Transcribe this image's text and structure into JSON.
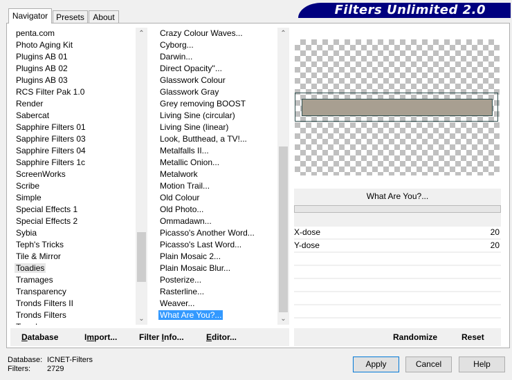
{
  "app": {
    "title": "Filters Unlimited 2.0"
  },
  "tabs": [
    {
      "label": "Navigator",
      "active": true
    },
    {
      "label": "Presets",
      "active": false
    },
    {
      "label": "About",
      "active": false
    }
  ],
  "categories": {
    "items": [
      "penta.com",
      "Photo Aging Kit",
      "Plugins AB 01",
      "Plugins AB 02",
      "Plugins AB 03",
      "RCS Filter Pak 1.0",
      "Render",
      "Sabercat",
      "Sapphire Filters 01",
      "Sapphire Filters 03",
      "Sapphire Filters 04",
      "Sapphire Filters 1c",
      "ScreenWorks",
      "Scribe",
      "Simple",
      "Special Effects 1",
      "Special Effects 2",
      "Sybia",
      "Teph's Tricks",
      "Tile & Mirror",
      "Toadies",
      "Tramages",
      "Transparency",
      "Tronds Filters II",
      "Tronds Filters",
      "Tronds..."
    ],
    "selected": "Toadies"
  },
  "filters": {
    "items": [
      "Crazy Colour Waves...",
      "Cyborg...",
      "Darwin...",
      "Direct Opacity''...",
      "Glasswork Colour",
      "Glasswork Gray",
      "Grey removing BOOST",
      "Living Sine (circular)",
      "Living Sine (linear)",
      "Look, Butthead, a TV!...",
      "Metalfalls II...",
      "Metallic Onion...",
      "Metalwork",
      "Motion Trail...",
      "Old Colour",
      "Old Photo...",
      "Ommadawn...",
      "Picasso's Another Word...",
      "Picasso's Last Word...",
      "Plain Mosaic 2...",
      "Plain Mosaic Blur...",
      "Posterize...",
      "Rasterline...",
      "Weaver...",
      "What Are You?..."
    ],
    "selected": "What Are You?..."
  },
  "preview": {
    "fill_color": "#a89f91",
    "border_color": "#2f4f4f"
  },
  "params": {
    "filter_name": "What Are You?...",
    "rows": [
      {
        "label": "X-dose",
        "value": "20"
      },
      {
        "label": "Y-dose",
        "value": "20"
      }
    ]
  },
  "left_buttons": [
    {
      "label": "Database",
      "mnemonic": "D"
    },
    {
      "label": "Import...",
      "mnemonic": "m"
    },
    {
      "label": "Filter Info...",
      "mnemonic": "I"
    },
    {
      "label": "Editor...",
      "mnemonic": "E"
    }
  ],
  "right_buttons": {
    "randomize": "Randomize",
    "reset": "Reset"
  },
  "status": {
    "database_label": "Database:",
    "database_value": "ICNET-Filters",
    "filters_label": "Filters:",
    "filters_value": "2729"
  },
  "dialog_buttons": {
    "apply": "Apply",
    "cancel": "Cancel",
    "help": "Help"
  }
}
